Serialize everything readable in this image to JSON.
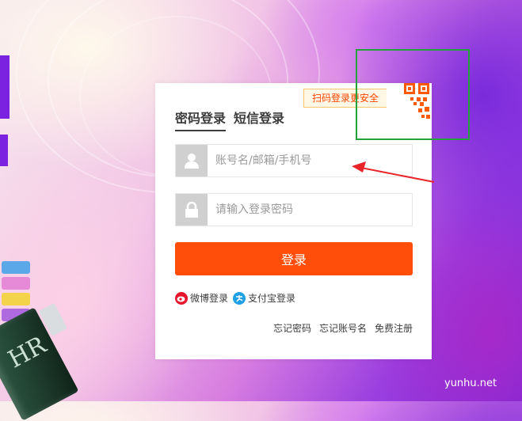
{
  "tabs": [
    {
      "label": "密码登录",
      "active": true
    },
    {
      "label": "短信登录",
      "active": false
    }
  ],
  "qr": {
    "tip": "扫码登录更安全",
    "icon": "qr-code-icon"
  },
  "username": {
    "placeholder": "账号名/邮箱/手机号",
    "value": "",
    "icon": "user-icon"
  },
  "password": {
    "placeholder": "请输入登录密码",
    "value": "",
    "icon": "lock-icon"
  },
  "login_button": {
    "label": "登录",
    "color": "#ff4e0a"
  },
  "social": {
    "weibo": {
      "label": "微博登录",
      "icon": "weibo-icon"
    },
    "alipay": {
      "label": "支付宝登录",
      "icon": "alipay-icon"
    }
  },
  "links": {
    "forgot_password": "忘记密码",
    "forgot_account": "忘记账号名",
    "register": "免费注册"
  },
  "background": {
    "bottle_text": "HR"
  },
  "watermark": "yunhu.net",
  "colors": {
    "accent": "#ff4e0a",
    "annotation_box": "#22a33a",
    "annotation_arrow": "#e8252a"
  }
}
